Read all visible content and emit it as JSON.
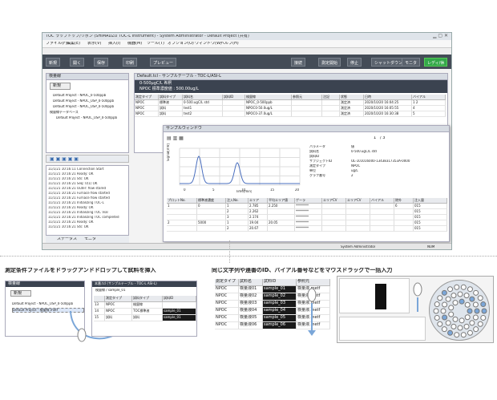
{
  "app": {
    "title": "TOC ラップトップ/リボン (SHIMADZU TOC-L Instrument) - System Administrator - Default Project (共有)",
    "menu": [
      "ファイル(F)",
      "編集(E)",
      "表示(V)",
      "挿入(I)",
      "機器(M)",
      "ツール(T)",
      "オプション(O)",
      "ウィンドウ(W)",
      "ヘルプ(H)"
    ],
    "toolbar": {
      "new": "新規",
      "open": "開く",
      "save": "保存",
      "print": "印刷",
      "preview": "プレビュー",
      "connect": "接続",
      "start": "測定開始",
      "stop": "停止",
      "shutdown": "シャットダウン",
      "monitor": "モニタ",
      "ready": "レディ/休"
    }
  },
  "explorer": {
    "title": "検量線",
    "new_btn": "新規",
    "items": [
      "Default Project - NPOC_0-500ppb",
      "Default Project - NPOC_USP_0-500ppb",
      "Default Project - NPOC_USP_0-500ppb",
      "検量線データベース",
      "Default Project - NPOC_USP_0-500ppb"
    ]
  },
  "log": {
    "lines": [
      "11/1/21 10:16:11  Connection Start",
      "11/1/21 10:16:21  Ready: OK",
      "11/1/21 10:16:21  Sts: OK",
      "11/1/21 10:16:21  Seq: 0(1) OK",
      "11/1/21 10:16:21  Outer: flow stared",
      "11/1/21 10:16:21  Furnace flow started",
      "11/1/21 10:16:21  Furnace flow started",
      "11/1/21 10:16:21  Initializing TOC-L",
      "11/1/21 10:16:21  Ready: OK",
      "11/1/21 10:16:21  Initializing  TOC Vial",
      "11/1/21 10:16:21  Initializing TOC completed",
      "11/1/21 10:16:21  Ready: OK",
      "11/1/21 10:16:21  Sts: OK"
    ],
    "tabs": [
      "ステータス",
      "モニタ"
    ]
  },
  "sampletable": {
    "title": "Default.tcl - サンプルテーブル - TOC-L/ASI-L",
    "sub1": "0-500µgC/L 希釈",
    "sub2": "NPOC 標準濃度値 : 500.00ug/L",
    "headers": [
      "測定タイプ",
      "試料タイプ",
      "試料名",
      "試料ID",
      "検量線",
      "参照元",
      "注記",
      "状態",
      "日時",
      "バイアル"
    ],
    "rows": [
      [
        "NPOC",
        "標準液",
        "0-500.ugC/L std",
        "",
        "NPOC_0-500ppb",
        "",
        "",
        "測定済",
        "2020/10/20 16:04:25",
        "1 2"
      ],
      [
        "NPOC",
        "試料",
        "test1",
        "",
        "NPOC0-50.0ug/L",
        "",
        "",
        "測定済",
        "2020/10/20 16:05:55",
        "4"
      ],
      [
        "NPOC",
        "試料",
        "test2",
        "",
        "NPOC0-37.0ug/L",
        "",
        "",
        "測定済",
        "2020/10/20 16:30:38",
        "5"
      ]
    ]
  },
  "chartwin": {
    "title": "サンプルウィンドウ",
    "page": "1",
    "total": "/ 3",
    "params": [
      [
        "パラメータ",
        "値"
      ],
      [
        "試料名",
        "0-500.ugC/L std"
      ],
      [
        "試料ID",
        ""
      ],
      [
        "サブジェクトID",
        "OL-101016000-13438317353A-0000"
      ],
      [
        "測定タイプ",
        "NPOC"
      ],
      [
        "単位",
        "ug/L"
      ],
      [
        "グラフ番号",
        "2"
      ]
    ],
    "ylabel": "Signal[mV]",
    "xlabel": "Time[min]",
    "xticks": [
      "0",
      "5",
      "10",
      "15",
      "20"
    ],
    "headers": [
      "プロットNo.",
      "標準液濃度",
      "注入No.",
      "エリア",
      "平均エリア値",
      "ゲーラ",
      "エリアCV",
      "エリアCV",
      "バイアル",
      "除外",
      "注入量"
    ],
    "rows": [
      [
        "1",
        "0",
        "1",
        "2.785",
        "2.250",
        "********",
        "",
        "",
        "",
        "6",
        "015"
      ],
      [
        "",
        "",
        "2",
        "2.262",
        "",
        "********",
        "",
        "",
        "",
        "",
        "015"
      ],
      [
        "",
        "",
        "3",
        "2.174",
        "",
        "********",
        "",
        "",
        "",
        "",
        "015"
      ],
      [
        "2",
        "5000",
        "1",
        "19.04",
        "20.05",
        "********",
        "",
        "",
        "",
        "",
        "015"
      ],
      [
        "",
        "",
        "2",
        "20.67",
        "",
        "********",
        "",
        "",
        "",
        "",
        "015"
      ]
    ],
    "status": "System Administrator",
    "num": "NUM"
  },
  "captions": {
    "left": "測定条件ファイルをドラッグアンドドロップして試料を挿入",
    "right": "同じ文字列や連番のID、バイアル番号などをマウスドラッグで一括入力"
  },
  "inset1": {
    "title": "検量線",
    "new_btn": "新規",
    "items": [
      "Default Project - NPOC_USP_0-500ppb",
      "Default Project - 検量線.metf"
    ]
  },
  "inset2": {
    "title": "本番.tcl (サンプルテーブル - TOC-L ASI-L)",
    "sub": "検量線 / sample_01",
    "headers": [
      "",
      "測定タイプ",
      "試料タイプ",
      "試料ID"
    ],
    "rows": [
      [
        "13",
        "NPOC",
        "検量線",
        ""
      ],
      [
        "14",
        "NPOC",
        "TOC標準液",
        "sample_01"
      ],
      [
        "15",
        "試料",
        "試料",
        "sample_01"
      ]
    ]
  },
  "inset3": {
    "headers": [
      "測定タイプ",
      "試料名",
      "試料ID",
      "参照元"
    ],
    "rows": [
      [
        "NPOC",
        "検量液01",
        "sample_01",
        "検量液.metf"
      ],
      [
        "NPOC",
        "検量液02",
        "sample_02",
        "検量液.metf"
      ],
      [
        "NPOC",
        "検量液03",
        "sample_03",
        "検量液.metf"
      ],
      [
        "NPOC",
        "検量液04",
        "sample_04",
        "検量液.metf"
      ],
      [
        "NPOC",
        "検量液05",
        "sample_05",
        "検量液.metf"
      ],
      [
        "NPOC",
        "検量液06",
        "sample_06",
        "検量液.metf"
      ]
    ]
  }
}
